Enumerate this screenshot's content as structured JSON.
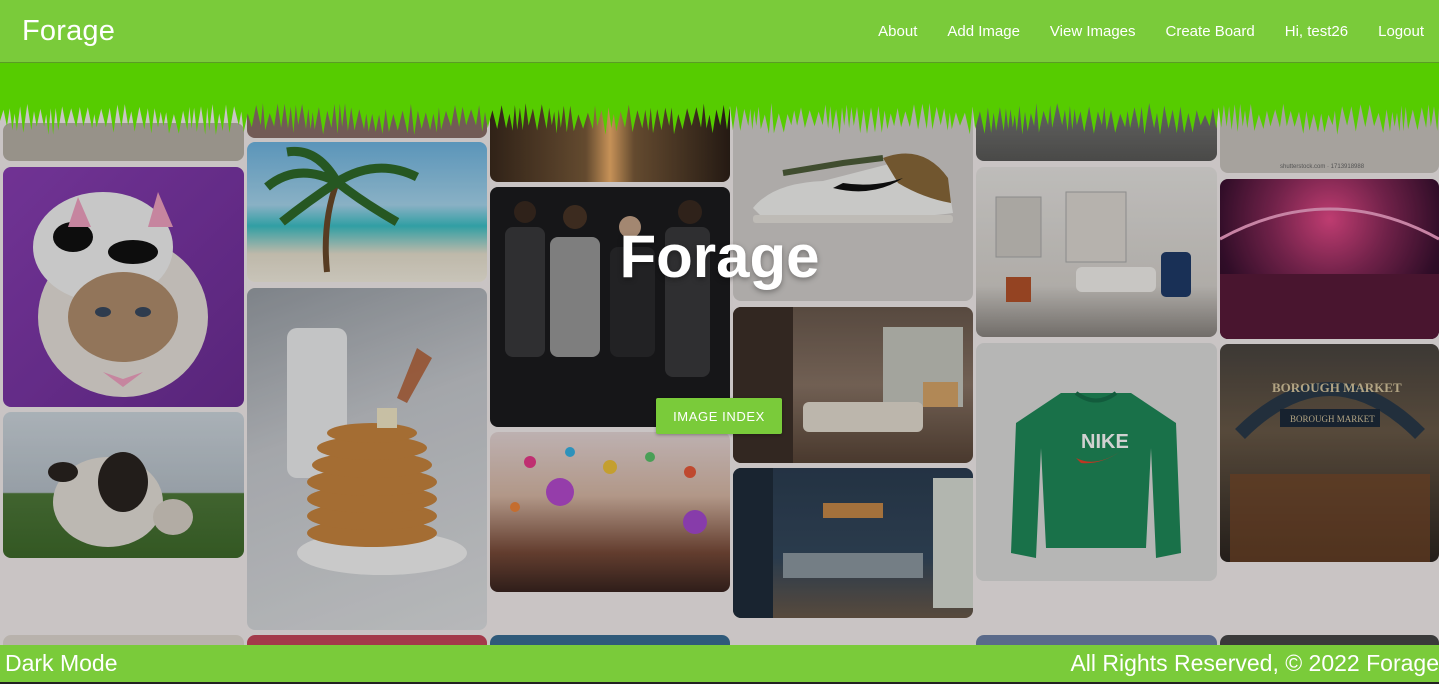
{
  "navbar": {
    "brand": "Forage",
    "links": [
      "About",
      "Add Image",
      "View Images",
      "Create Board",
      "Hi, test26",
      "Logout"
    ]
  },
  "hero": {
    "title": "Forage",
    "button_label": "IMAGE INDEX"
  },
  "footer": {
    "left": "Dark Mode",
    "right": "All Rights Reserved, © 2022 Forage"
  },
  "colors": {
    "accent": "#7acb3a",
    "band": "#56cc00",
    "page_bg": "#c9c4c4"
  },
  "gallery_images": [
    "cat in cow hat",
    "palm beach",
    "city street",
    "sneaker",
    "street traffic",
    "shutterstock photo",
    "cow in field",
    "pancakes with syrup",
    "fashion runway",
    "living room interior",
    "white living room",
    "concert hall",
    "festival confetti",
    "kitchen interior",
    "green nike sweatshirt",
    "borough market"
  ],
  "watermark_text": "shutterstock.com · 1713918988"
}
